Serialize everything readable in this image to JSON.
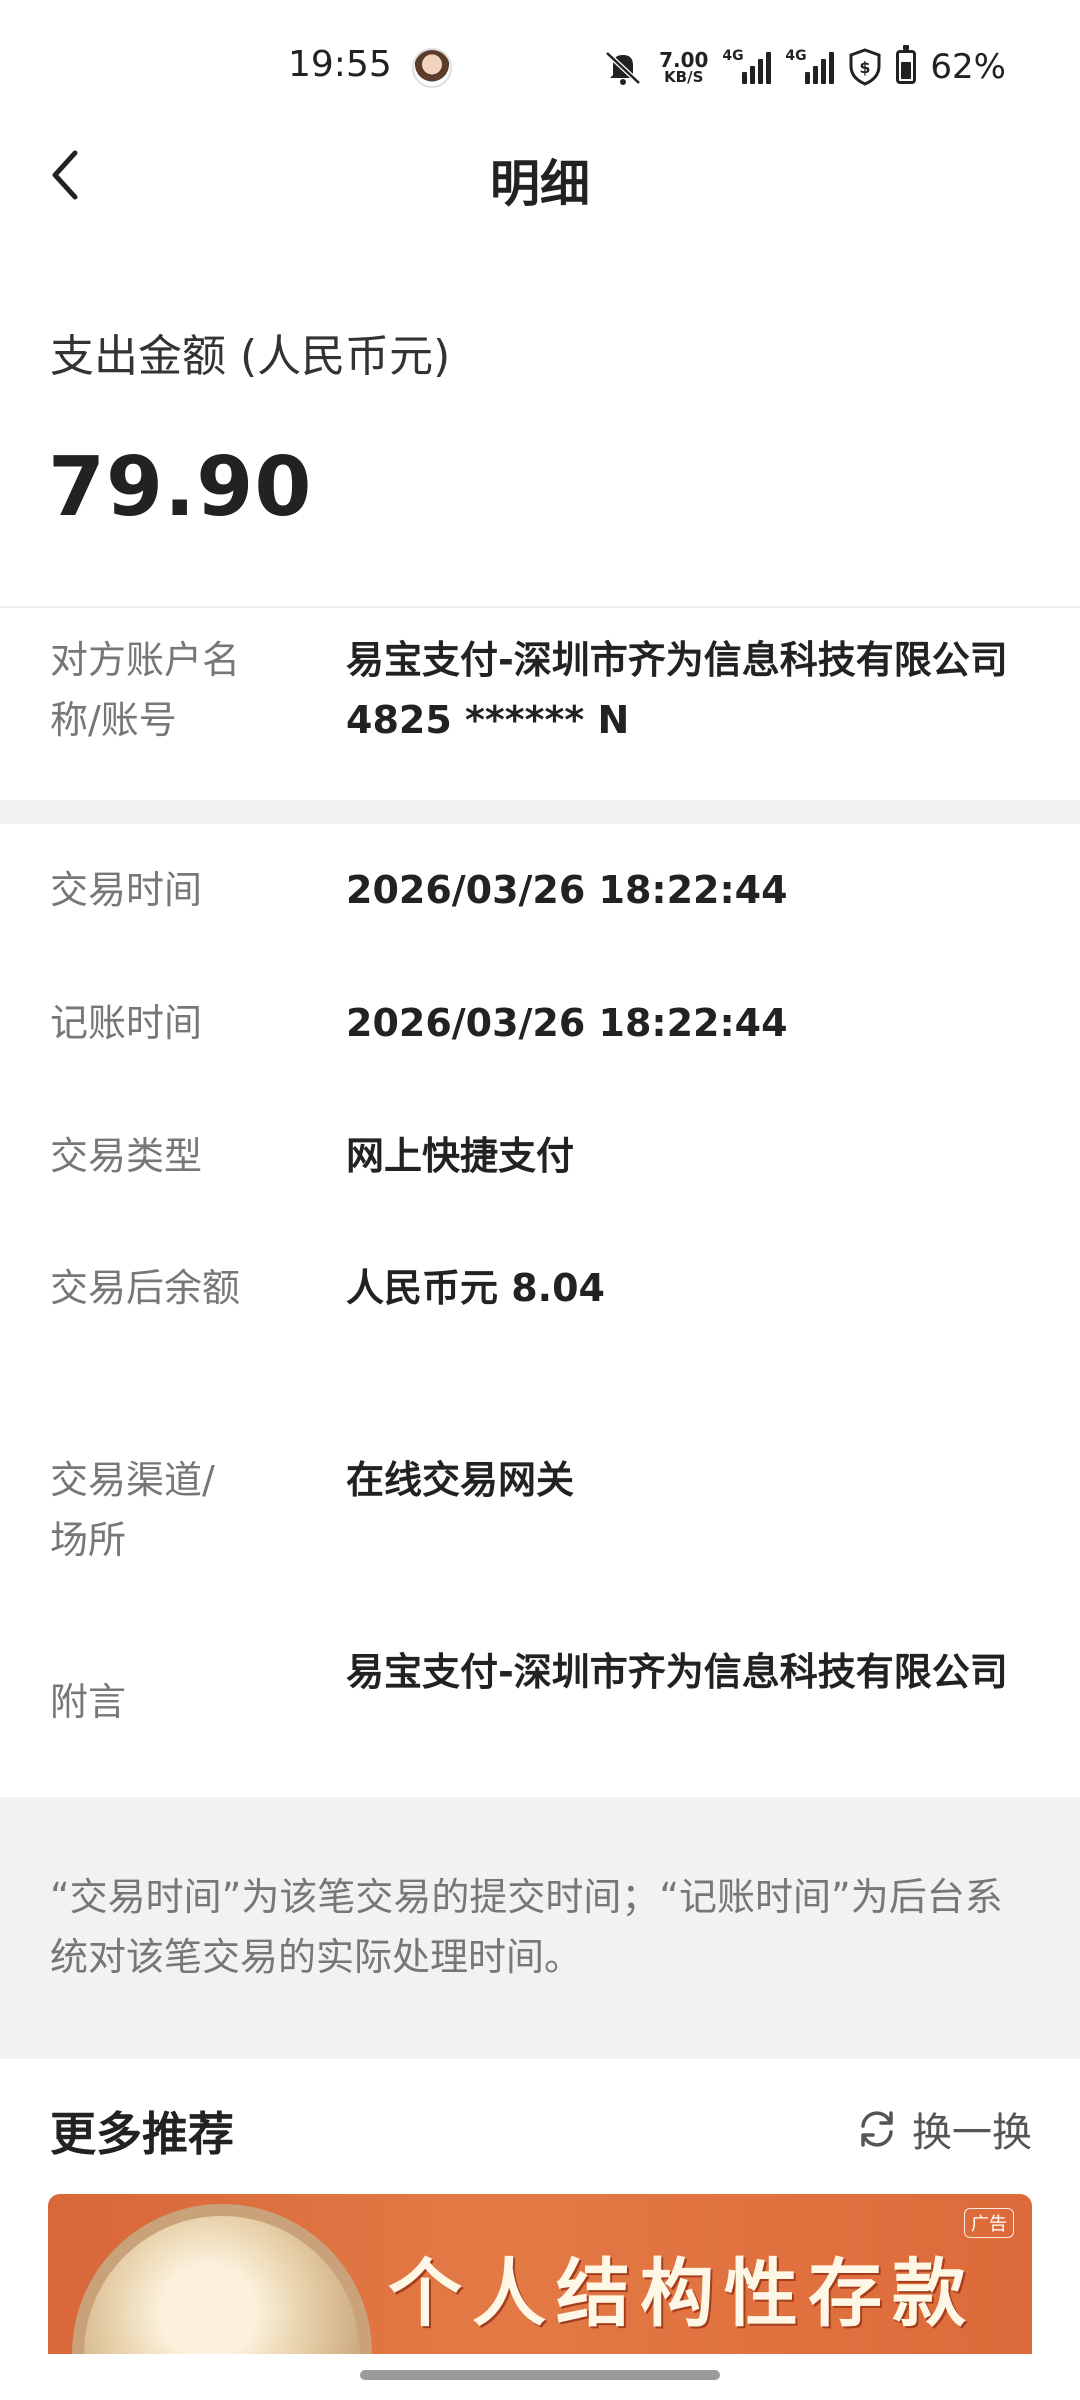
{
  "status_bar": {
    "time": "19:55",
    "net_speed_value": "7.00",
    "net_speed_unit": "KB/S",
    "sim1_tag": "4G",
    "sim2_tag": "4G",
    "battery_percent": "62%",
    "battery_level": 0.62
  },
  "header": {
    "title": "明细"
  },
  "amount": {
    "label": "支出金额 (人民币元)",
    "value": "79.90"
  },
  "details": {
    "counterparty_label": "对方账户名称/账号",
    "counterparty_value": "易宝支付-深圳市齐为信息科技有限公司 4825 ****** N",
    "trade_time_label": "交易时间",
    "trade_time_value": "2026/03/26 18:22:44",
    "booking_time_label": "记账时间",
    "booking_time_value": "2026/03/26 18:22:44",
    "trade_type_label": "交易类型",
    "trade_type_value": "网上快捷支付",
    "balance_label": "交易后余额",
    "balance_value": "人民币元 8.04",
    "channel_label": "交易渠道/场所",
    "channel_value": "在线交易网关",
    "remark_label": "附言",
    "remark_value": "易宝支付-深圳市齐为信息科技有限公司"
  },
  "note": {
    "text": "“交易时间”为该笔交易的提交时间；“记账时间”为后台系统对该笔交易的实际处理时间。"
  },
  "recommend": {
    "title": "更多推荐",
    "refresh_label": "换一换",
    "banner_text": "个人结构性存款",
    "ad_tag": "广告"
  }
}
